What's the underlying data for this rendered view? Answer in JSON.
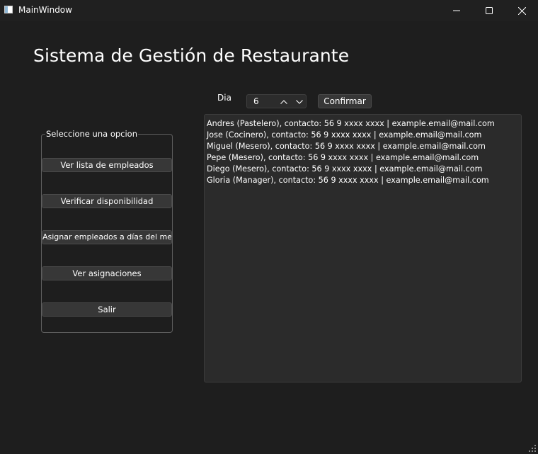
{
  "window": {
    "title": "MainWindow",
    "minimize_icon": "minimize-icon",
    "maximize_icon": "maximize-icon",
    "close_icon": "close-icon"
  },
  "heading": "Sistema de Gestión de Restaurante",
  "menu": {
    "group_title": "Seleccione una opcion",
    "buttons": [
      "Ver lista de empleados",
      "Verificar disponibilidad",
      "Asignar empleados a días del mes",
      "Ver asignaciones",
      "Salir"
    ]
  },
  "day_selector": {
    "label": "Dia",
    "value": "6",
    "confirm_label": "Confirmar"
  },
  "output": {
    "lines": [
      "Andres (Pastelero), contacto: 56 9 xxxx xxxx | example.email@mail.com",
      "Jose (Cocinero), contacto: 56 9 xxxx xxxx | example.email@mail.com",
      "Miguel (Mesero), contacto: 56 9 xxxx xxxx | example.email@mail.com",
      "Pepe (Mesero), contacto: 56 9 xxxx xxxx | example.email@mail.com",
      "Diego (Mesero), contacto: 56 9 xxxx xxxx | example.email@mail.com",
      "Gloria (Manager), contacto: 56 9 xxxx xxxx | example.email@mail.com"
    ]
  },
  "colors": {
    "background": "#1e1e1e",
    "button": "#373737",
    "textarea": "#2b2b2b",
    "text": "#ffffff"
  }
}
